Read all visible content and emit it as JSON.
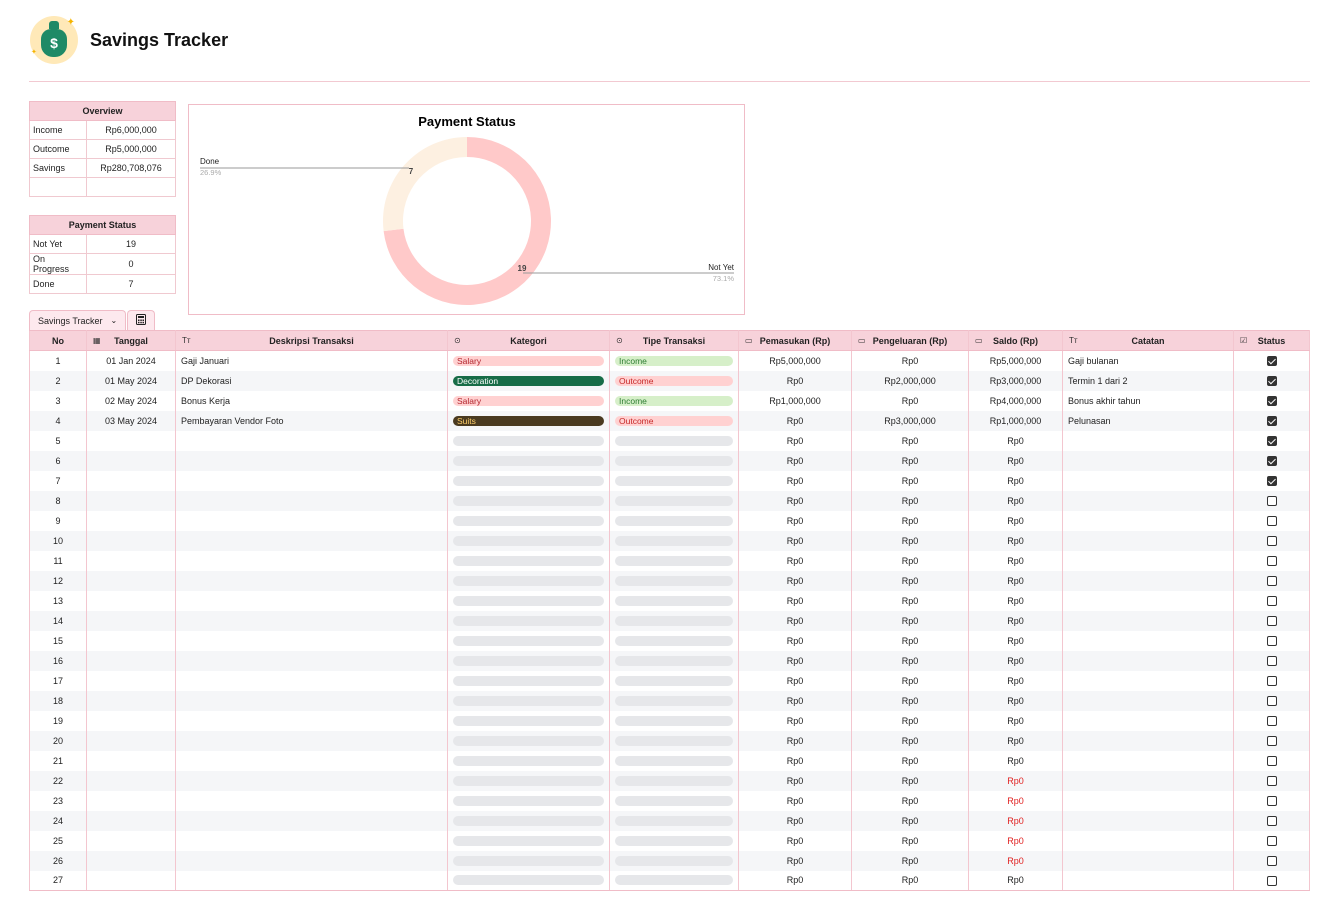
{
  "app": {
    "title": "Savings Tracker"
  },
  "overview": {
    "header": "Overview",
    "rows": [
      {
        "label": "Income",
        "value": "Rp6,000,000"
      },
      {
        "label": "Outcome",
        "value": "Rp5,000,000"
      },
      {
        "label": "Savings",
        "value": "Rp280,708,076"
      },
      {
        "label": "",
        "value": ""
      }
    ]
  },
  "payment_status_table": {
    "header": "Payment Status",
    "rows": [
      {
        "label": "Not Yet",
        "value": "19"
      },
      {
        "label": "On Progress",
        "value": "0"
      },
      {
        "label": "Done",
        "value": "7"
      }
    ]
  },
  "chart_data": {
    "type": "pie",
    "title": "Payment Status",
    "donut": true,
    "slices": [
      {
        "label": "Done",
        "value": 7,
        "percent": "26.9%",
        "color": "#fdf0e1"
      },
      {
        "label": "Not Yet",
        "value": 19,
        "percent": "73.1%",
        "color": "#ffc9c9"
      }
    ]
  },
  "tabs": {
    "sheet_label": "Savings Tracker",
    "chevron": "chevron-down-icon",
    "second_icon": "calculator-icon"
  },
  "columns": [
    "No",
    "Tanggal",
    "Deskripsi Transaksi",
    "Kategori",
    "Tipe Transaksi",
    "Pemasukan (Rp)",
    "Pengeluaran (Rp)",
    "Saldo (Rp)",
    "Catatan",
    "Status"
  ],
  "column_icons": [
    "",
    "calendar-icon",
    "text-icon",
    "select-icon",
    "select-icon",
    "money-icon",
    "money-icon",
    "money-icon",
    "text-icon",
    "checkbox-icon"
  ],
  "colors": {
    "Salary": {
      "bg": "#ffd1d1",
      "fg": "#b3262e"
    },
    "Decoration": {
      "bg": "#176c47",
      "fg": "#ffffff"
    },
    "Suits": {
      "bg": "#4a3a20",
      "fg": "#ffcf6b"
    },
    "Income": {
      "bg": "#d6efc9",
      "fg": "#2e7d32"
    },
    "Outcome": {
      "bg": "#ffd1d1",
      "fg": "#c62828"
    }
  },
  "rows": [
    {
      "no": "1",
      "tanggal": "01 Jan 2024",
      "deskripsi": "Gaji Januari",
      "kategori": "Salary",
      "tipe": "Income",
      "pemasukan": "Rp5,000,000",
      "pengeluaran": "Rp0",
      "saldo": "Rp5,000,000",
      "catatan": "Gaji bulanan",
      "status": true,
      "saldo_red": false
    },
    {
      "no": "2",
      "tanggal": "01 May 2024",
      "deskripsi": "DP Dekorasi",
      "kategori": "Decoration",
      "tipe": "Outcome",
      "pemasukan": "Rp0",
      "pengeluaran": "Rp2,000,000",
      "saldo": "Rp3,000,000",
      "catatan": "Termin 1 dari 2",
      "status": true,
      "saldo_red": false
    },
    {
      "no": "3",
      "tanggal": "02 May 2024",
      "deskripsi": "Bonus Kerja",
      "kategori": "Salary",
      "tipe": "Income",
      "pemasukan": "Rp1,000,000",
      "pengeluaran": "Rp0",
      "saldo": "Rp4,000,000",
      "catatan": "Bonus akhir tahun",
      "status": true,
      "saldo_red": false
    },
    {
      "no": "4",
      "tanggal": "03 May 2024",
      "deskripsi": "Pembayaran Vendor Foto",
      "kategori": "Suits",
      "tipe": "Outcome",
      "pemasukan": "Rp0",
      "pengeluaran": "Rp3,000,000",
      "saldo": "Rp1,000,000",
      "catatan": "Pelunasan",
      "status": true,
      "saldo_red": false
    },
    {
      "no": "5",
      "tanggal": "",
      "deskripsi": "",
      "kategori": "",
      "tipe": "",
      "pemasukan": "Rp0",
      "pengeluaran": "Rp0",
      "saldo": "Rp0",
      "catatan": "",
      "status": true,
      "saldo_red": false
    },
    {
      "no": "6",
      "tanggal": "",
      "deskripsi": "",
      "kategori": "",
      "tipe": "",
      "pemasukan": "Rp0",
      "pengeluaran": "Rp0",
      "saldo": "Rp0",
      "catatan": "",
      "status": true,
      "saldo_red": false
    },
    {
      "no": "7",
      "tanggal": "",
      "deskripsi": "",
      "kategori": "",
      "tipe": "",
      "pemasukan": "Rp0",
      "pengeluaran": "Rp0",
      "saldo": "Rp0",
      "catatan": "",
      "status": true,
      "saldo_red": false
    },
    {
      "no": "8",
      "tanggal": "",
      "deskripsi": "",
      "kategori": "",
      "tipe": "",
      "pemasukan": "Rp0",
      "pengeluaran": "Rp0",
      "saldo": "Rp0",
      "catatan": "",
      "status": false,
      "saldo_red": false
    },
    {
      "no": "9",
      "tanggal": "",
      "deskripsi": "",
      "kategori": "",
      "tipe": "",
      "pemasukan": "Rp0",
      "pengeluaran": "Rp0",
      "saldo": "Rp0",
      "catatan": "",
      "status": false,
      "saldo_red": false
    },
    {
      "no": "10",
      "tanggal": "",
      "deskripsi": "",
      "kategori": "",
      "tipe": "",
      "pemasukan": "Rp0",
      "pengeluaran": "Rp0",
      "saldo": "Rp0",
      "catatan": "",
      "status": false,
      "saldo_red": false
    },
    {
      "no": "11",
      "tanggal": "",
      "deskripsi": "",
      "kategori": "",
      "tipe": "",
      "pemasukan": "Rp0",
      "pengeluaran": "Rp0",
      "saldo": "Rp0",
      "catatan": "",
      "status": false,
      "saldo_red": false
    },
    {
      "no": "12",
      "tanggal": "",
      "deskripsi": "",
      "kategori": "",
      "tipe": "",
      "pemasukan": "Rp0",
      "pengeluaran": "Rp0",
      "saldo": "Rp0",
      "catatan": "",
      "status": false,
      "saldo_red": false
    },
    {
      "no": "13",
      "tanggal": "",
      "deskripsi": "",
      "kategori": "",
      "tipe": "",
      "pemasukan": "Rp0",
      "pengeluaran": "Rp0",
      "saldo": "Rp0",
      "catatan": "",
      "status": false,
      "saldo_red": false
    },
    {
      "no": "14",
      "tanggal": "",
      "deskripsi": "",
      "kategori": "",
      "tipe": "",
      "pemasukan": "Rp0",
      "pengeluaran": "Rp0",
      "saldo": "Rp0",
      "catatan": "",
      "status": false,
      "saldo_red": false
    },
    {
      "no": "15",
      "tanggal": "",
      "deskripsi": "",
      "kategori": "",
      "tipe": "",
      "pemasukan": "Rp0",
      "pengeluaran": "Rp0",
      "saldo": "Rp0",
      "catatan": "",
      "status": false,
      "saldo_red": false
    },
    {
      "no": "16",
      "tanggal": "",
      "deskripsi": "",
      "kategori": "",
      "tipe": "",
      "pemasukan": "Rp0",
      "pengeluaran": "Rp0",
      "saldo": "Rp0",
      "catatan": "",
      "status": false,
      "saldo_red": false
    },
    {
      "no": "17",
      "tanggal": "",
      "deskripsi": "",
      "kategori": "",
      "tipe": "",
      "pemasukan": "Rp0",
      "pengeluaran": "Rp0",
      "saldo": "Rp0",
      "catatan": "",
      "status": false,
      "saldo_red": false
    },
    {
      "no": "18",
      "tanggal": "",
      "deskripsi": "",
      "kategori": "",
      "tipe": "",
      "pemasukan": "Rp0",
      "pengeluaran": "Rp0",
      "saldo": "Rp0",
      "catatan": "",
      "status": false,
      "saldo_red": false
    },
    {
      "no": "19",
      "tanggal": "",
      "deskripsi": "",
      "kategori": "",
      "tipe": "",
      "pemasukan": "Rp0",
      "pengeluaran": "Rp0",
      "saldo": "Rp0",
      "catatan": "",
      "status": false,
      "saldo_red": false
    },
    {
      "no": "20",
      "tanggal": "",
      "deskripsi": "",
      "kategori": "",
      "tipe": "",
      "pemasukan": "Rp0",
      "pengeluaran": "Rp0",
      "saldo": "Rp0",
      "catatan": "",
      "status": false,
      "saldo_red": false
    },
    {
      "no": "21",
      "tanggal": "",
      "deskripsi": "",
      "kategori": "",
      "tipe": "",
      "pemasukan": "Rp0",
      "pengeluaran": "Rp0",
      "saldo": "Rp0",
      "catatan": "",
      "status": false,
      "saldo_red": false
    },
    {
      "no": "22",
      "tanggal": "",
      "deskripsi": "",
      "kategori": "",
      "tipe": "",
      "pemasukan": "Rp0",
      "pengeluaran": "Rp0",
      "saldo": "Rp0",
      "catatan": "",
      "status": false,
      "saldo_red": true
    },
    {
      "no": "23",
      "tanggal": "",
      "deskripsi": "",
      "kategori": "",
      "tipe": "",
      "pemasukan": "Rp0",
      "pengeluaran": "Rp0",
      "saldo": "Rp0",
      "catatan": "",
      "status": false,
      "saldo_red": true
    },
    {
      "no": "24",
      "tanggal": "",
      "deskripsi": "",
      "kategori": "",
      "tipe": "",
      "pemasukan": "Rp0",
      "pengeluaran": "Rp0",
      "saldo": "Rp0",
      "catatan": "",
      "status": false,
      "saldo_red": true
    },
    {
      "no": "25",
      "tanggal": "",
      "deskripsi": "",
      "kategori": "",
      "tipe": "",
      "pemasukan": "Rp0",
      "pengeluaran": "Rp0",
      "saldo": "Rp0",
      "catatan": "",
      "status": false,
      "saldo_red": true
    },
    {
      "no": "26",
      "tanggal": "",
      "deskripsi": "",
      "kategori": "",
      "tipe": "",
      "pemasukan": "Rp0",
      "pengeluaran": "Rp0",
      "saldo": "Rp0",
      "catatan": "",
      "status": false,
      "saldo_red": true
    },
    {
      "no": "27",
      "tanggal": "",
      "deskripsi": "",
      "kategori": "",
      "tipe": "",
      "pemasukan": "Rp0",
      "pengeluaran": "Rp0",
      "saldo": "Rp0",
      "catatan": "",
      "status": false,
      "saldo_red": false
    }
  ]
}
